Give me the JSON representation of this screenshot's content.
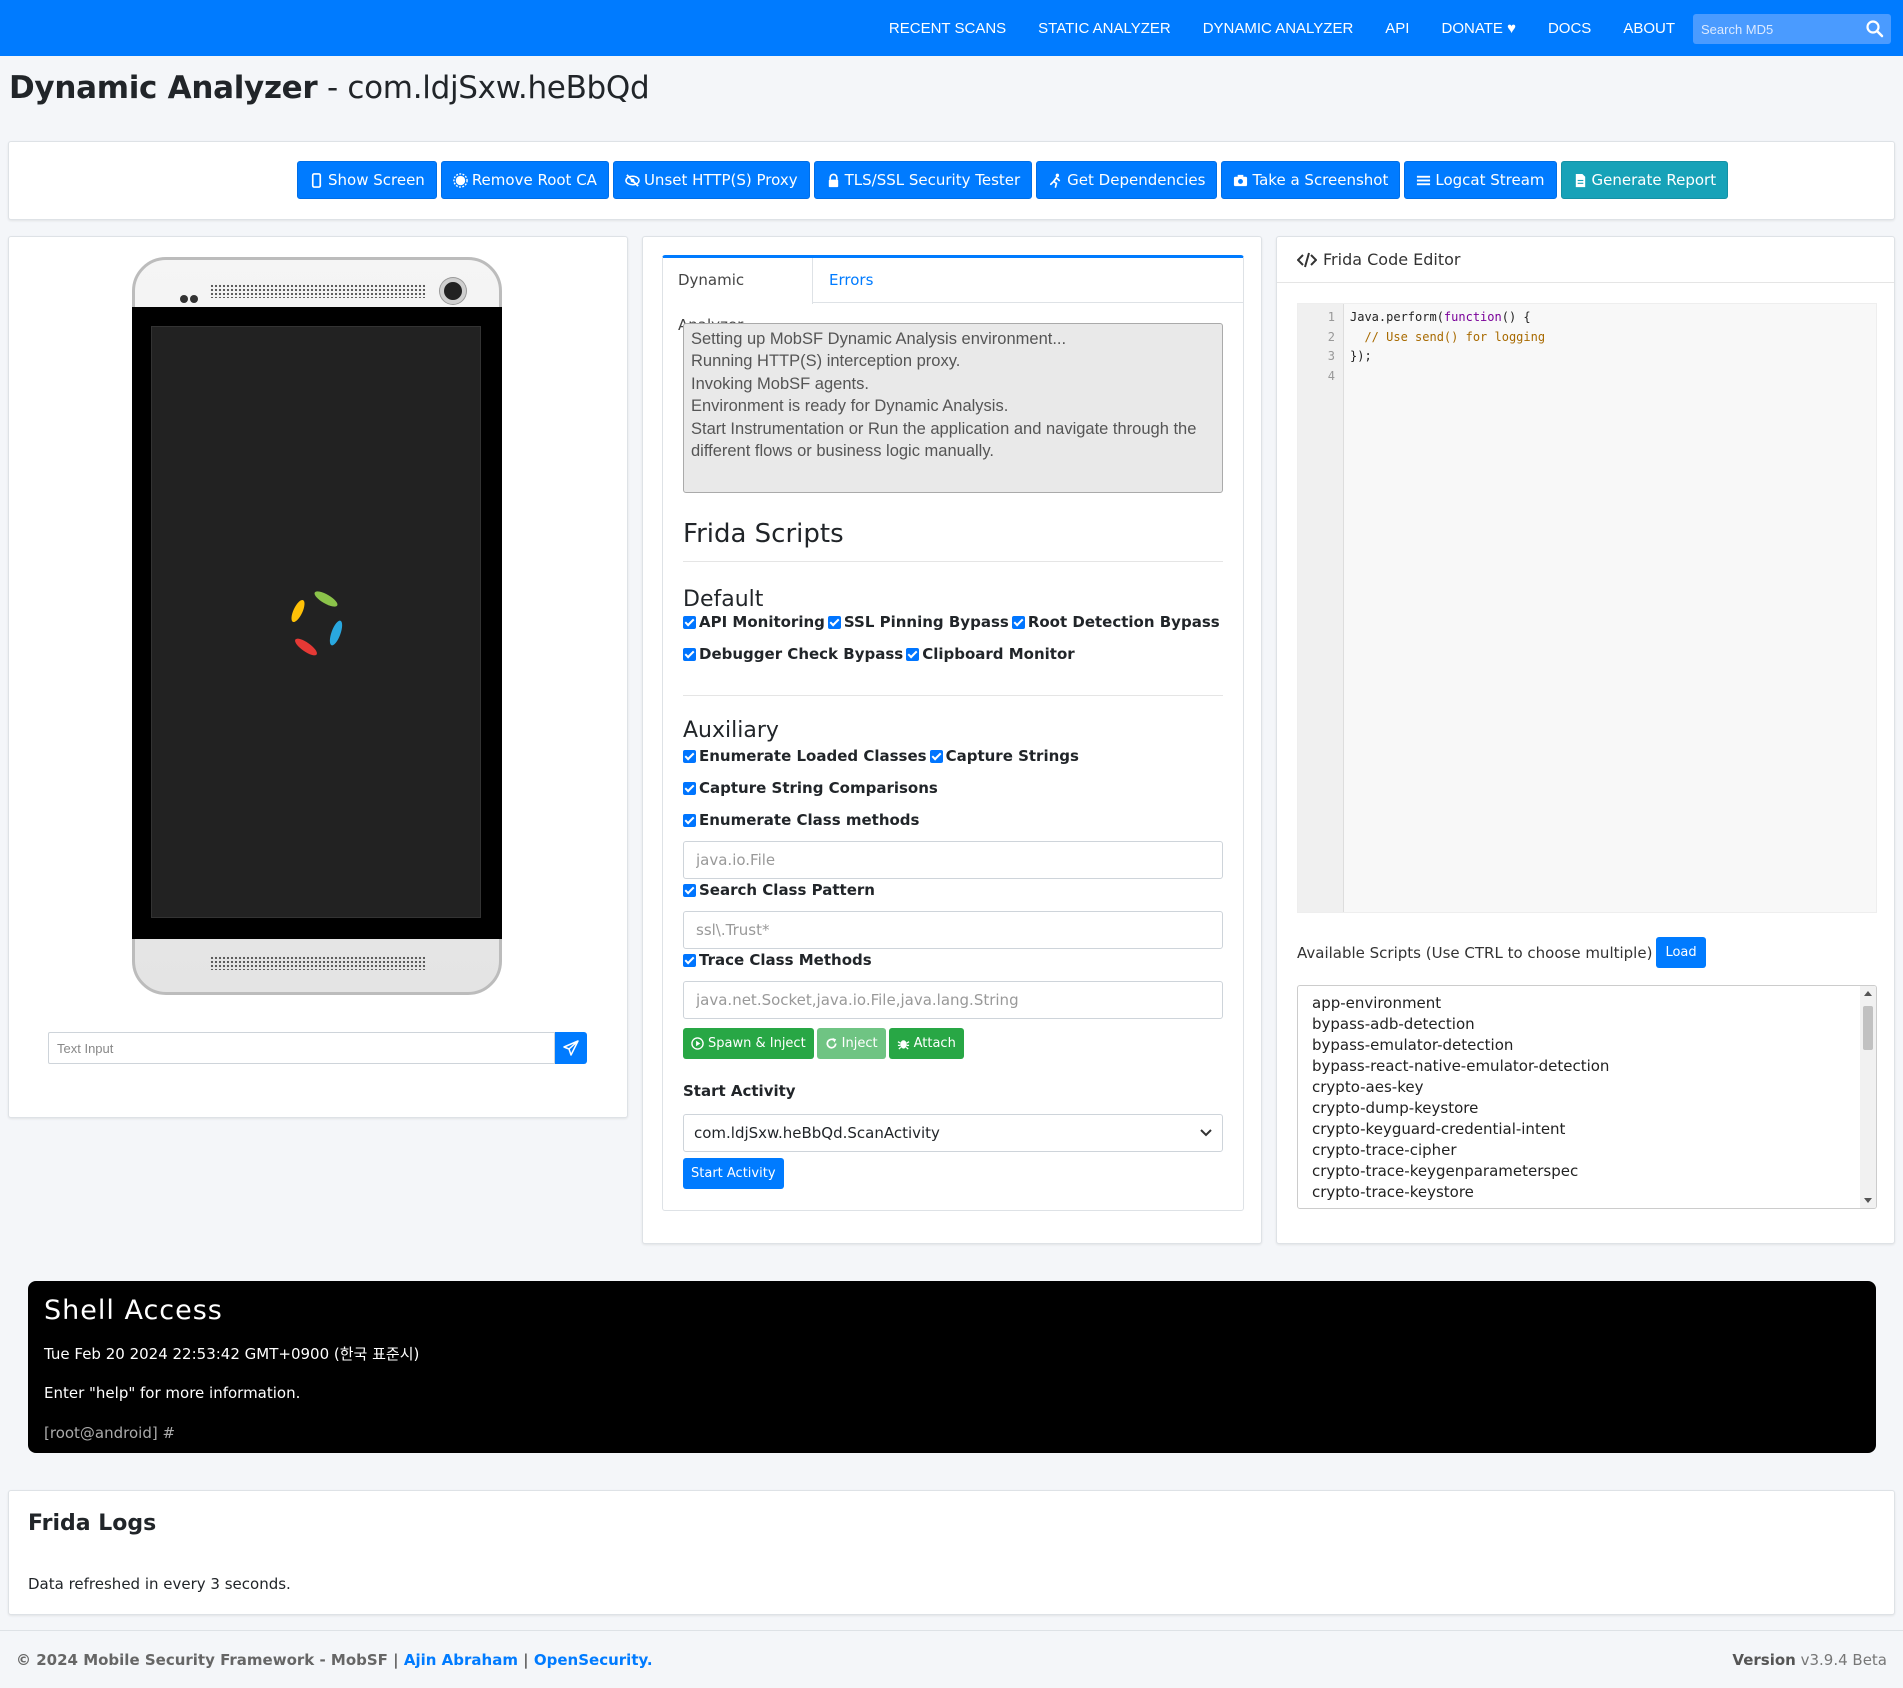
{
  "nav": {
    "links": [
      "RECENT SCANS",
      "STATIC ANALYZER",
      "DYNAMIC ANALYZER",
      "API",
      "DONATE",
      "DOCS",
      "ABOUT"
    ],
    "search_placeholder": "Search MD5",
    "brand_color": "#007bff"
  },
  "title": {
    "bold": "Dynamic Analyzer",
    "rest": " - com.ldjSxw.heBbQd"
  },
  "toolbar": {
    "show_screen": "Show Screen",
    "remove_root_ca": "Remove Root CA",
    "unset_proxy": "Unset HTTP(S) Proxy",
    "tls_tester": "TLS/SSL Security Tester",
    "get_deps": "Get Dependencies",
    "screenshot": "Take a Screenshot",
    "logcat": "Logcat Stream",
    "report": "Generate Report"
  },
  "phone": {
    "text_input_placeholder": "Text Input"
  },
  "tabs": {
    "active": "Dynamic Analyzer",
    "errors": "Errors"
  },
  "log_text": "Setting up MobSF Dynamic Analysis environment...\nRunning HTTP(S) interception proxy.\nInvoking MobSF agents.\nEnvironment is ready for Dynamic Analysis.\nStart Instrumentation or Run the application and navigate through the different flows or business logic manually.",
  "frida": {
    "title": "Frida Scripts",
    "default_title": "Default",
    "default": {
      "api_monitoring": "API Monitoring",
      "ssl_pinning": "SSL Pinning Bypass",
      "root_detection": "Root Detection Bypass",
      "debugger": "Debugger Check Bypass",
      "clipboard": "Clipboard Monitor"
    },
    "aux_title": "Auxiliary",
    "aux": {
      "enum_classes": "Enumerate Loaded Classes",
      "capture_strings": "Capture Strings",
      "capture_compare": "Capture String Comparisons",
      "enum_methods": "Enumerate Class methods",
      "enum_methods_ph": "java.io.File",
      "search_pattern": "Search Class Pattern",
      "search_pattern_ph": "ssl\\.Trust*",
      "trace_methods": "Trace Class Methods",
      "trace_methods_ph": "java.net.Socket,java.io.File,java.lang.String"
    },
    "spawn": "Spawn & Inject",
    "inject": "Inject",
    "attach": "Attach",
    "start_activity_label": "Start Activity",
    "start_activity_value": "com.ldjSxw.heBbQd.ScanActivity",
    "start_activity_btn": "Start Activity"
  },
  "editor": {
    "title": "Frida Code Editor",
    "line_numbers": [
      "1",
      "2",
      "3",
      "4"
    ],
    "line1_a": "Java.perform(",
    "line1_kw": "function",
    "line1_b": "() {",
    "line2": "  // Use send() for logging",
    "line3": "});",
    "available_label": "Available Scripts (Use CTRL to choose multiple)",
    "load": "Load",
    "scripts": [
      "app-environment",
      "bypass-adb-detection",
      "bypass-emulator-detection",
      "bypass-react-native-emulator-detection",
      "crypto-aes-key",
      "crypto-dump-keystore",
      "crypto-keyguard-credential-intent",
      "crypto-trace-cipher",
      "crypto-trace-keygenparameterspec",
      "crypto-trace-keystore"
    ]
  },
  "shell": {
    "title": "Shell Access",
    "date": "Tue Feb 20 2024 22:53:42 GMT+0900 (한국 표준시)",
    "help": "Enter \"help\" for more information.",
    "prompt": "[root@android] #"
  },
  "logs": {
    "title": "Frida Logs",
    "text": "Data refreshed in every 3 seconds."
  },
  "footer": {
    "copyright": "© 2024 Mobile Security Framework - MobSF | ",
    "author": "Ajin Abraham",
    "sep": " | ",
    "org": "OpenSecurity.",
    "version_label": "Version",
    "version": " v3.9.4 Beta"
  }
}
